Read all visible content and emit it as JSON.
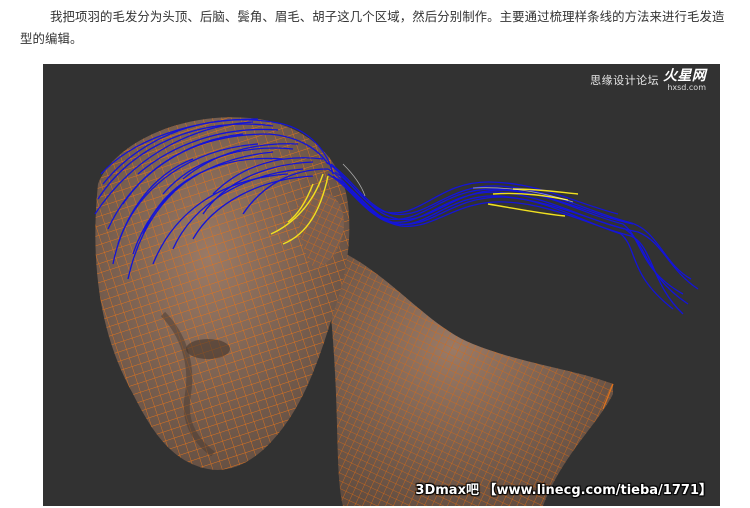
{
  "article": {
    "paragraph": "我把项羽的毛发分为头顶、后脑、鬓角、眉毛、胡子这几个区域，然后分别制作。主要通过梳理样条线的方法来进行毛发造型的编辑。"
  },
  "figure": {
    "logo_text": "思缘设计论坛",
    "logo_brand": "火星网",
    "logo_domain": "hxsd.com",
    "watermark": "3Dmax吧 【www.linecg.com/tieba/1771】",
    "colors": {
      "background": "#323232",
      "skin": "#8a6d5c",
      "wire": "#e0731c",
      "splines": "#1414d8",
      "selected_splines": "#f0e020"
    }
  }
}
